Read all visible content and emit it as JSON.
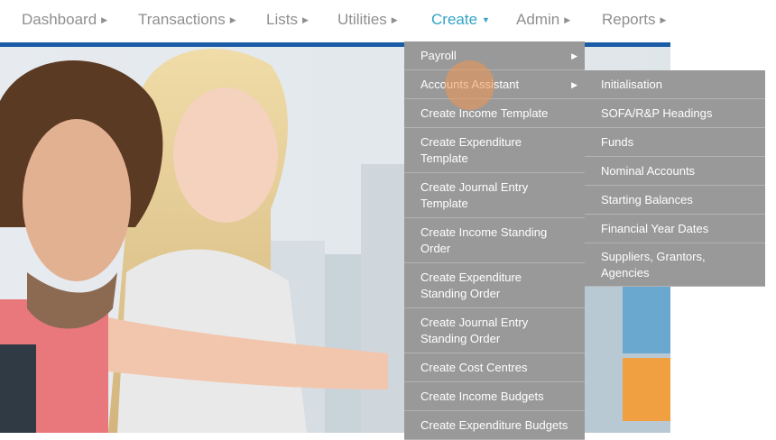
{
  "nav": {
    "items": [
      {
        "label": "Dashboard"
      },
      {
        "label": "Transactions"
      },
      {
        "label": "Lists"
      },
      {
        "label": "Utilities"
      },
      {
        "label": "Create"
      },
      {
        "label": "Admin"
      },
      {
        "label": "Reports"
      }
    ],
    "active_color": "#32a3c6",
    "bar_color": "#1a5da6"
  },
  "create_menu": {
    "items": [
      {
        "label": "Payroll"
      },
      {
        "label": "Accounts Assistant"
      },
      {
        "label": "Create Income Template"
      },
      {
        "label": "Create Expenditure Template"
      },
      {
        "label": "Create Journal Entry Template"
      },
      {
        "label": "Create Income Standing Order"
      },
      {
        "label": "Create Expenditure Standing Order"
      },
      {
        "label": "Create Journal Entry Standing Order"
      },
      {
        "label": "Create Cost Centres"
      },
      {
        "label": "Create Income Budgets"
      },
      {
        "label": "Create Expenditure Budgets"
      }
    ]
  },
  "accounts_assistant_menu": {
    "items": [
      {
        "label": "Initialisation"
      },
      {
        "label": "SOFA/R&P Headings"
      },
      {
        "label": "Funds"
      },
      {
        "label": "Nominal Accounts"
      },
      {
        "label": "Starting Balances"
      },
      {
        "label": "Financial Year Dates"
      },
      {
        "label": "Suppliers, Grantors, Agencies"
      }
    ]
  }
}
